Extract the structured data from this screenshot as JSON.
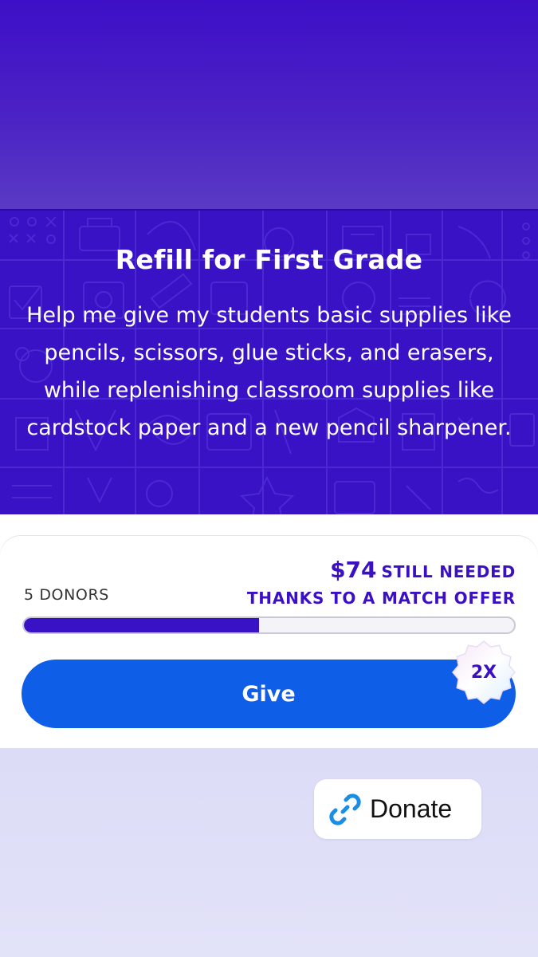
{
  "hero": {
    "title": "Refill for First Grade",
    "description": "Help me give my students basic supplies like pencils, scissors, glue sticks, and erasers, while replenishing classroom supplies like cardstock paper and a new pencil sharpener."
  },
  "funding": {
    "donors_label": "5 DONORS",
    "amount_needed": "$74",
    "still_needed_label": "STILL NEEDED",
    "match_label": "THANKS TO A MATCH OFFER",
    "progress_percent": 48
  },
  "give_button": {
    "label": "Give"
  },
  "match_badge": {
    "label": "2X",
    "icon": "match-badge-icon"
  },
  "donate_chip": {
    "label": "Donate",
    "icon": "link-icon"
  },
  "colors": {
    "brand_purple": "#3812c4",
    "button_blue": "#0f5ee8",
    "link_blue": "#1a8ee6"
  }
}
